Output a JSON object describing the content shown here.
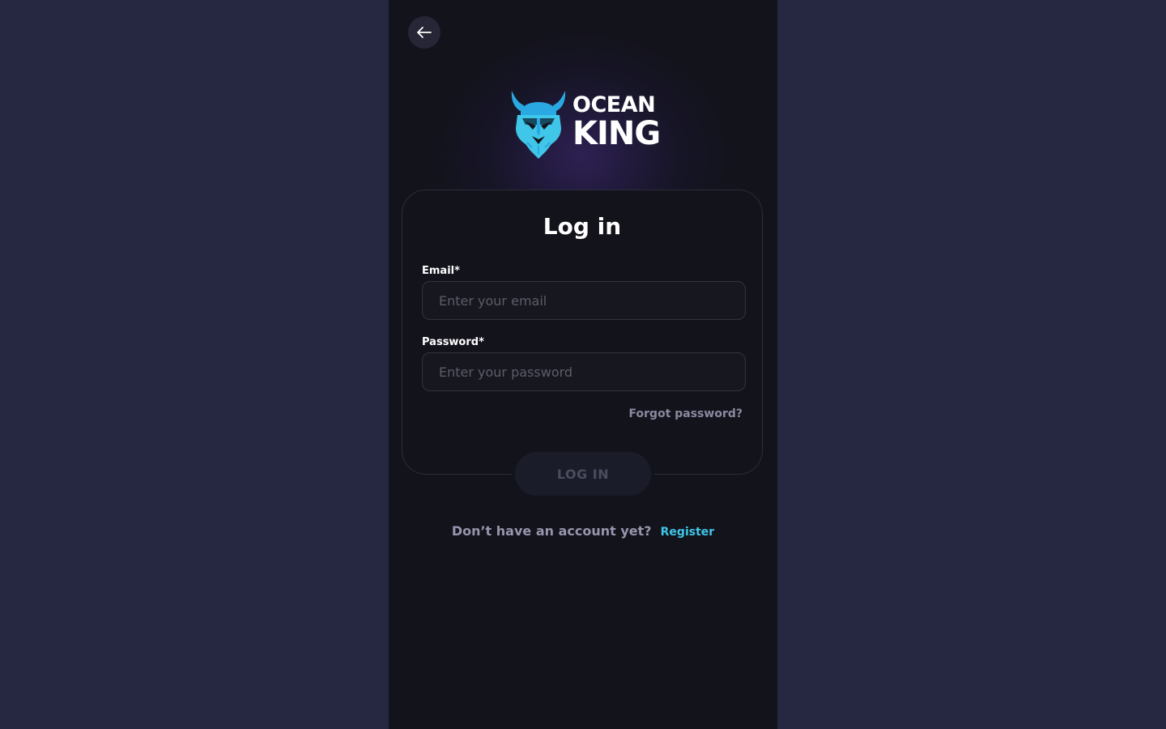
{
  "brand": {
    "name_line1": "OCEAN",
    "name_line2": "KING",
    "accent_color": "#3fc6e8"
  },
  "nav": {
    "back_icon": "arrow-left-icon"
  },
  "login": {
    "title": "Log in",
    "email_label": "Email*",
    "email_placeholder": "Enter your email",
    "email_value": "",
    "password_label": "Password*",
    "password_placeholder": "Enter your password",
    "password_value": "",
    "forgot_label": "Forgot password?",
    "submit_label": "LOG IN"
  },
  "register": {
    "prompt": "Don’t have an account yet?",
    "link_label": "Register"
  }
}
